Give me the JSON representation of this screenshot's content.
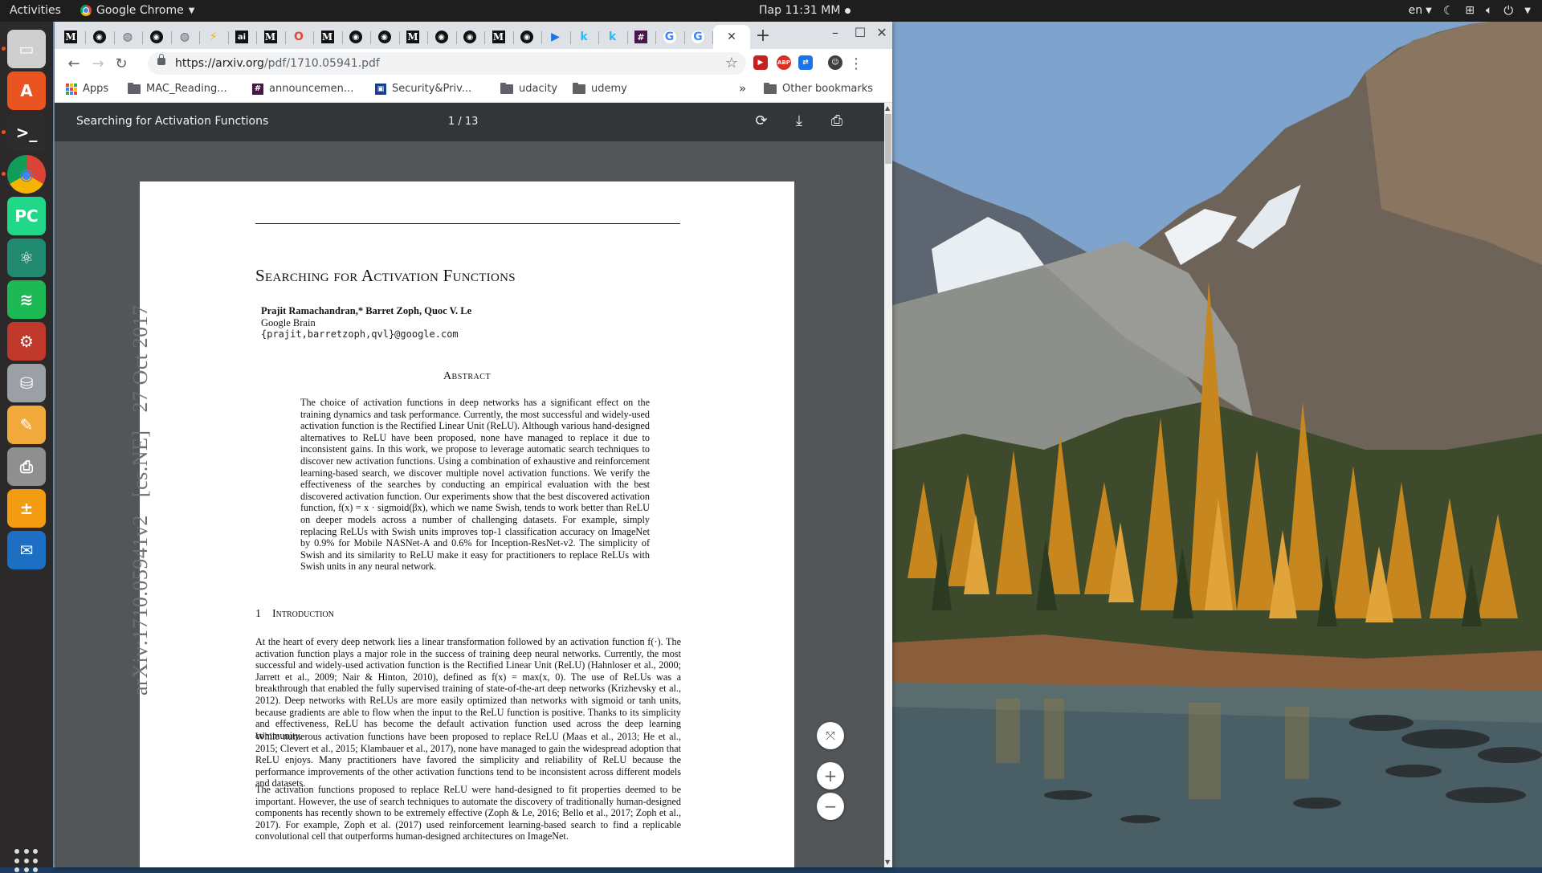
{
  "topbar": {
    "activities": "Activities",
    "app_name": "Google Chrome",
    "clock": "Пар 11:31 ММ",
    "language": "en"
  },
  "dock": {
    "items": [
      {
        "icon": "files-icon",
        "color": "#cfcfcf"
      },
      {
        "icon": "software-center-icon",
        "color": "#e95420"
      },
      {
        "icon": "terminal-icon",
        "color": "#2c2c2c"
      },
      {
        "icon": "chrome-icon",
        "color": "#4285f4"
      },
      {
        "icon": "pycharm-icon",
        "color": "#21d789"
      },
      {
        "icon": "atom-icon",
        "color": "#1f8a70"
      },
      {
        "icon": "spotify-icon",
        "color": "#1db954"
      },
      {
        "icon": "system-settings-icon",
        "color": "#c0392b"
      },
      {
        "icon": "disk-utility-icon",
        "color": "#9aa0a6"
      },
      {
        "icon": "text-editor-icon",
        "color": "#f2a93b"
      },
      {
        "icon": "printer-icon",
        "color": "#8f8f8f"
      },
      {
        "icon": "calculator-icon",
        "color": "#f39c12"
      },
      {
        "icon": "thunderbird-icon",
        "color": "#1d6fc4"
      }
    ]
  },
  "browser": {
    "tabs": [
      {
        "icon": "medium-icon",
        "glyph": "M"
      },
      {
        "icon": "github-icon",
        "glyph": "◉"
      },
      {
        "icon": "globe-icon",
        "glyph": "◍"
      },
      {
        "icon": "github-icon",
        "glyph": "◉"
      },
      {
        "icon": "globe-icon",
        "glyph": "◍"
      },
      {
        "icon": "bolt-icon",
        "glyph": "⚡"
      },
      {
        "icon": "ai-icon",
        "glyph": "ai"
      },
      {
        "icon": "medium-icon",
        "glyph": "M"
      },
      {
        "icon": "opera-icon",
        "glyph": "O"
      },
      {
        "icon": "medium-icon",
        "glyph": "M"
      },
      {
        "icon": "github-icon",
        "glyph": "◉"
      },
      {
        "icon": "github-icon",
        "glyph": "◉"
      },
      {
        "icon": "medium-icon",
        "glyph": "M"
      },
      {
        "icon": "github-icon",
        "glyph": "◉"
      },
      {
        "icon": "github-icon",
        "glyph": "◉"
      },
      {
        "icon": "medium-icon",
        "glyph": "M"
      },
      {
        "icon": "github-icon",
        "glyph": "◉"
      },
      {
        "icon": "play-icon",
        "glyph": "▶"
      },
      {
        "icon": "kaggle-icon",
        "glyph": "k"
      },
      {
        "icon": "kaggle-icon",
        "glyph": "k"
      },
      {
        "icon": "slack-icon",
        "glyph": "#"
      },
      {
        "icon": "google-icon",
        "glyph": "G"
      },
      {
        "icon": "google-icon",
        "glyph": "G"
      }
    ],
    "new_tab": "+",
    "url_host": "https://arxiv.org",
    "url_path": "/pdf/1710.05941.pdf",
    "bookmarks": {
      "apps": "Apps",
      "items": [
        {
          "label": "MAC_Reading...",
          "icon": "folder-icon"
        },
        {
          "label": "announcemen...",
          "icon": "slack-icon"
        },
        {
          "label": "Security&Priv...",
          "icon": "bookmark-site-icon"
        },
        {
          "label": "udacity",
          "icon": "folder-icon"
        },
        {
          "label": "udemy",
          "icon": "folder-icon"
        }
      ],
      "overflow": "»",
      "other": "Other bookmarks"
    }
  },
  "pdf": {
    "title": "Searching for Activation Functions",
    "page_indicator": "1 / 13",
    "paper": {
      "title": "Searching for Activation Functions",
      "authors": "Prajit Ramachandran,* Barret Zoph, Quoc V. Le",
      "affiliation": "Google Brain",
      "email": "{prajit,barretzoph,qvl}@google.com",
      "abstract_heading": "Abstract",
      "abstract": "The choice of activation functions in deep networks has a significant effect on the training dynamics and task performance. Currently, the most successful and widely-used activation function is the Rectified Linear Unit (ReLU). Although various hand-designed alternatives to ReLU have been proposed, none have managed to replace it due to inconsistent gains. In this work, we propose to leverage automatic search techniques to discover new activation functions. Using a combination of exhaustive and reinforcement learning-based search, we discover multiple novel activation functions. We verify the effectiveness of the searches by conducting an empirical evaluation with the best discovered activation function. Our experiments show that the best discovered activation function, f(x) = x · sigmoid(βx), which we name Swish, tends to work better than ReLU on deeper models across a number of challenging datasets. For example, simply replacing ReLUs with Swish units improves top-1 classification accuracy on ImageNet by 0.9% for Mobile NASNet-A and 0.6% for Inception-ResNet-v2. The simplicity of Swish and its similarity to ReLU make it easy for practitioners to replace ReLUs with Swish units in any neural network.",
      "section_number": "1",
      "section_title": "Introduction",
      "paragraphs": [
        "At the heart of every deep network lies a linear transformation followed by an activation function f(·). The activation function plays a major role in the success of training deep neural networks. Currently, the most successful and widely-used activation function is the Rectified Linear Unit (ReLU) (Hahnloser et al., 2000; Jarrett et al., 2009; Nair & Hinton, 2010), defined as f(x) = max(x, 0). The use of ReLUs was a breakthrough that enabled the fully supervised training of state-of-the-art deep networks (Krizhevsky et al., 2012). Deep networks with ReLUs are more easily optimized than networks with sigmoid or tanh units, because gradients are able to flow when the input to the ReLU function is positive. Thanks to its simplicity and effectiveness, ReLU has become the default activation function used across the deep learning community.",
        "While numerous activation functions have been proposed to replace ReLU (Maas et al., 2013; He et al., 2015; Clevert et al., 2015; Klambauer et al., 2017), none have managed to gain the widespread adoption that ReLU enjoys. Many practitioners have favored the simplicity and reliability of ReLU because the performance improvements of the other activation functions tend to be inconsistent across different models and datasets.",
        "The activation functions proposed to replace ReLU were hand-designed to fit properties deemed to be important. However, the use of search techniques to automate the discovery of traditionally human-designed components has recently shown to be extremely effective (Zoph & Le, 2016; Bello et al., 2017; Zoph et al., 2017). For example, Zoph et al. (2017) used reinforcement learning-based search to find a replicable convolutional cell that outperforms human-designed architectures on ImageNet."
      ],
      "arxiv_id": "arXiv:1710.05941v2",
      "arxiv_category": "[cs.NE]",
      "arxiv_date": "27 Oct 2017"
    },
    "zoom_fit": "⤧",
    "zoom_in": "+",
    "zoom_out": "−"
  }
}
